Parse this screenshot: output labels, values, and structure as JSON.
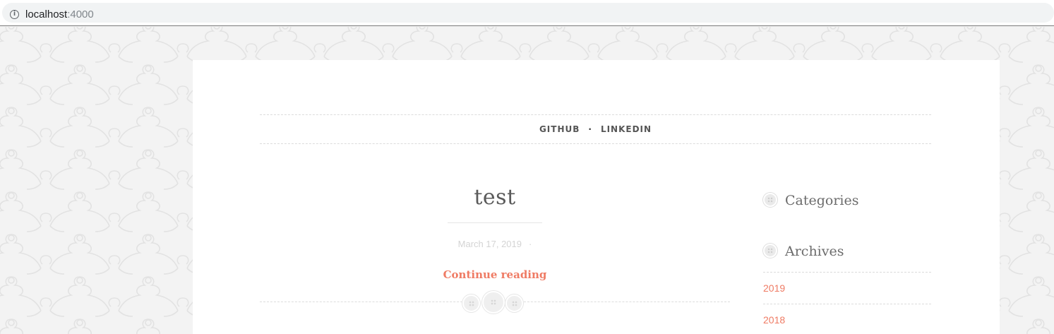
{
  "browser": {
    "url_host": "localhost",
    "url_port": ":4000",
    "info_icon_glyph": "i"
  },
  "nav": {
    "items": [
      {
        "label": "GITHUB"
      },
      {
        "label": "LINKEDIN"
      }
    ],
    "separator": "·"
  },
  "post": {
    "title": "test",
    "date": "March 17, 2019",
    "meta_separator": "·",
    "continue_label": "Continue reading"
  },
  "sidebar": {
    "categories_title": "Categories",
    "archives_title": "Archives",
    "archives": [
      {
        "label": "2019"
      },
      {
        "label": "2018"
      }
    ]
  },
  "colors": {
    "accent": "#ef7b64",
    "background": "#f3f3f3",
    "card": "#ffffff"
  },
  "icons": {
    "info": "info-icon",
    "widget_bullet": "button-icon",
    "post_divider": "buttons-icon"
  }
}
